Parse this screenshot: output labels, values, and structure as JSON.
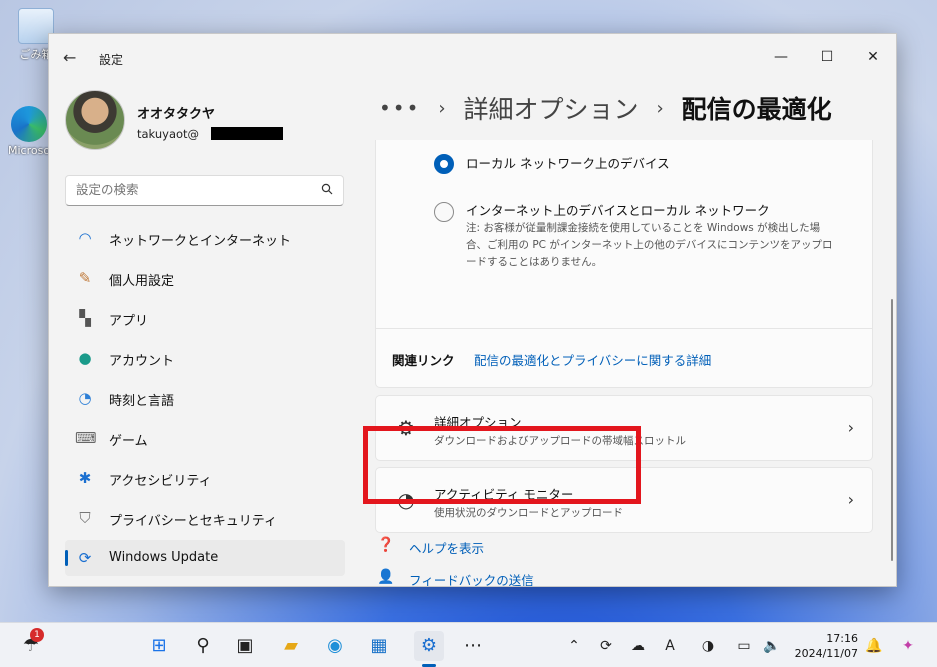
{
  "desktop": {
    "icons": [
      {
        "label": "ごみ箱"
      },
      {
        "label": "Microsoft Edge"
      }
    ]
  },
  "window": {
    "title": "設定",
    "controls": {
      "minimize": "—",
      "maximize": "☐",
      "close": "✕"
    }
  },
  "profile": {
    "name": "オオタタクヤ",
    "email": "takuyaot@"
  },
  "search": {
    "placeholder": "設定の検索"
  },
  "sidebar": {
    "items": [
      {
        "label": "ネットワークとインターネット",
        "icon": "wifi-icon"
      },
      {
        "label": "個人用設定",
        "icon": "brush-icon"
      },
      {
        "label": "アプリ",
        "icon": "apps-icon"
      },
      {
        "label": "アカウント",
        "icon": "person-icon"
      },
      {
        "label": "時刻と言語",
        "icon": "globe-clock-icon"
      },
      {
        "label": "ゲーム",
        "icon": "gamepad-icon"
      },
      {
        "label": "アクセシビリティ",
        "icon": "accessibility-icon"
      },
      {
        "label": "プライバシーとセキュリティ",
        "icon": "shield-icon"
      },
      {
        "label": "Windows Update",
        "icon": "update-icon"
      }
    ],
    "active_index": 8
  },
  "breadcrumb": {
    "more": "•••",
    "parent": "詳細オプション",
    "current": "配信の最適化"
  },
  "options": {
    "local": {
      "label": "ローカル ネットワーク上のデバイス",
      "selected": true
    },
    "internet": {
      "label": "インターネット上のデバイスとローカル ネットワーク",
      "selected": false,
      "note": "注: お客様が従量制課金接続を使用していることを Windows が検出した場合、ご利用の PC がインターネット上の他のデバイスにコンテンツをアップロードすることはありません。"
    }
  },
  "related": {
    "label": "関連リンク",
    "link": "配信の最適化とプライバシーに関する詳細"
  },
  "rows": {
    "advanced": {
      "title": "詳細オプション",
      "subtitle": "ダウンロードおよびアップロードの帯域幅スロットル"
    },
    "activity": {
      "title": "アクティビティ モニター",
      "subtitle": "使用状況のダウンロードとアップロード"
    }
  },
  "help": {
    "show_help": "ヘルプを表示",
    "feedback": "フィードバックの送信"
  },
  "taskbar": {
    "weather_badge": "1",
    "clock_time": "17:16",
    "clock_date": "2024/11/07",
    "ime": "A"
  },
  "colors": {
    "accent": "#005fb8",
    "highlight": "#e3161d"
  }
}
